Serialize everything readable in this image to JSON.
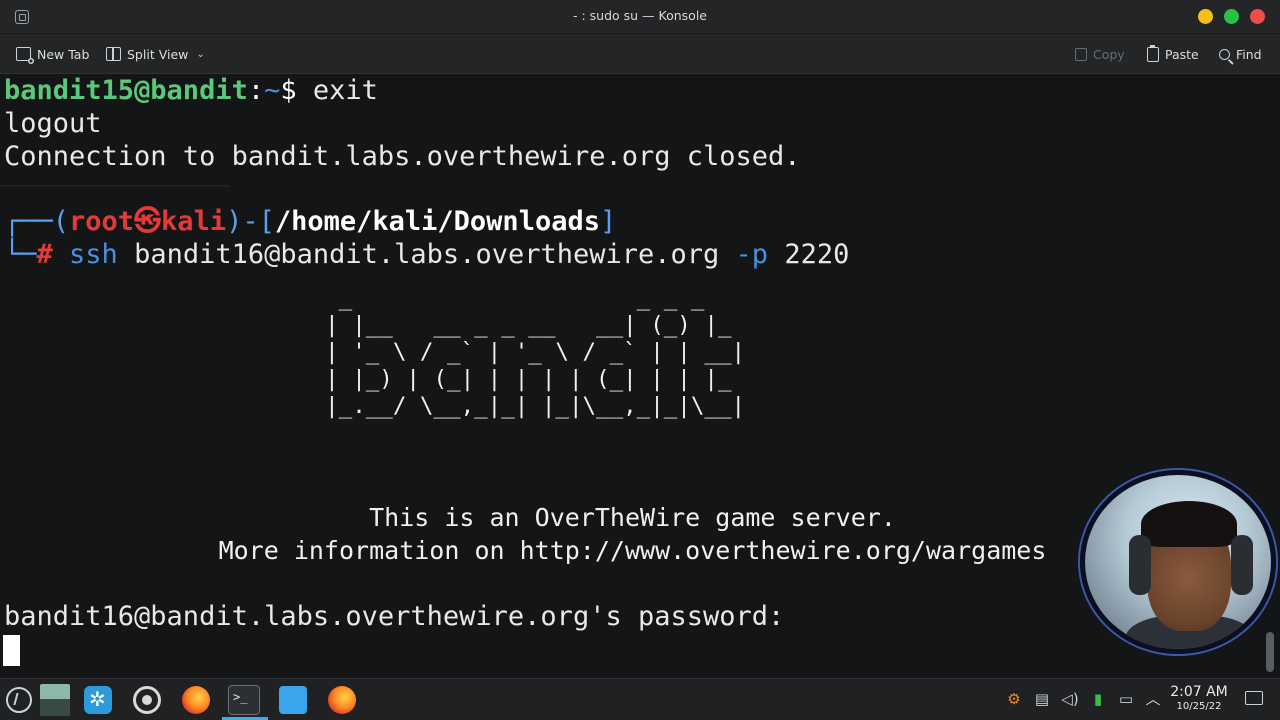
{
  "window": {
    "title": "- : sudo su — Konsole"
  },
  "toolbar": {
    "new_tab": "New Tab",
    "split_view": "Split View",
    "copy": "Copy",
    "paste": "Paste",
    "find": "Find"
  },
  "terminal": {
    "prompt1_user": "bandit15@bandit",
    "prompt1_colon": ":",
    "prompt1_path": "~",
    "prompt1_dollar": "$ ",
    "prompt1_cmd": "exit",
    "out_logout": "logout",
    "out_closed": "Connection to bandit.labs.overthewire.org closed.",
    "kali_open": "┌──(",
    "kali_user": "root㉿kali",
    "kali_mid": ")-[",
    "kali_path": "/home/kali/Downloads",
    "kali_close": "]",
    "kali_hash": "#",
    "kali_cmd": "ssh",
    "kali_args": " bandit16@bandit.labs.overthewire.org ",
    "kali_flag": "-p",
    "kali_port": " 2220",
    "banner_art": "                         _                     _ _ _\n                        | |__   __ _ _ __   __| (_) |_\n                        | '_ \\ / _` | '_ \\ / _` | | __|\n                        | |_) | (_| | | | | (_| | | |_\n                        |_.__/ \\__,_|_| |_|\\__,_|_|\\__|",
    "banner_line1": "This is an OverTheWire game server.",
    "banner_line2": "More information on http://www.overthewire.org/wargames",
    "password_prompt": "bandit16@bandit.labs.overthewire.org's password:"
  },
  "taskbar": {
    "clock_time": "2:07 AM",
    "clock_date": "10/25/22"
  },
  "colors": {
    "accent": "#3daee9",
    "prompt_green": "#5cc87a",
    "kali_red": "#e53a3a",
    "kali_blue": "#4c8fe0"
  }
}
